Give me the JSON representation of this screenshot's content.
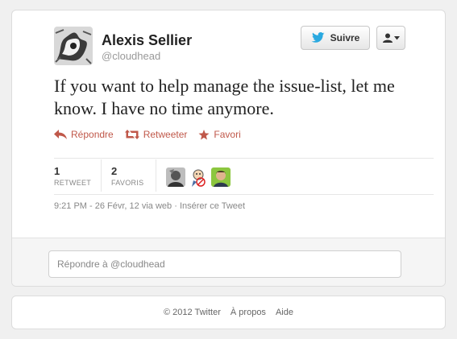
{
  "author": {
    "name": "Alexis Sellier",
    "handle": "@cloudhead"
  },
  "header": {
    "follow_label": "Suivre",
    "user_menu_icon": "user-dropdown-icon"
  },
  "tweet": {
    "text": "If you want to help manage the issue-list, let me know. I have no time anymore."
  },
  "actions": {
    "reply_label": "Répondre",
    "retweet_label": "Retweeter",
    "favorite_label": "Favori"
  },
  "stats": {
    "retweets_count": "1",
    "retweets_label": "RETWEET",
    "favorites_count": "2",
    "favorites_label": "FAVORIS"
  },
  "meta": {
    "timestamp": "9:21 PM - 26 Févr, 12",
    "via": "via web",
    "separator": "·",
    "embed_label": "Insérer ce Tweet"
  },
  "reply": {
    "placeholder": "Répondre à @cloudhead"
  },
  "footer": {
    "copyright": "© 2012 Twitter",
    "about": "À propos",
    "help": "Aide"
  },
  "colors": {
    "accent": "#c0584a",
    "twitter_blue": "#2aa9e0"
  }
}
